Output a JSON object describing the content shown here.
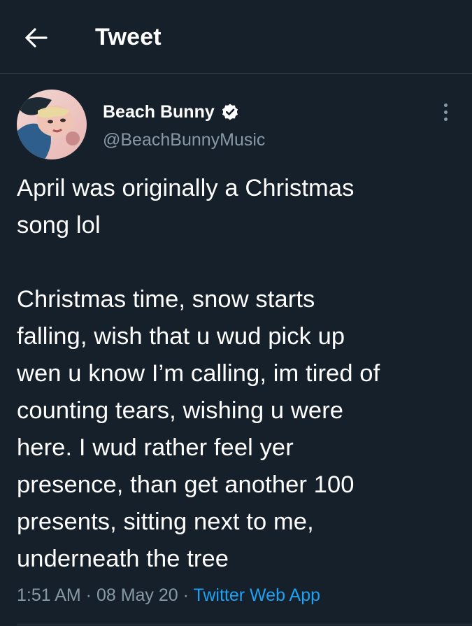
{
  "header": {
    "title": "Tweet",
    "back_icon": "arrow-left-icon"
  },
  "author": {
    "name": "Beach Bunny",
    "handle": "@BeachBunnyMusic",
    "verified_icon": "verified-badge-icon",
    "avatar": "profile-photo"
  },
  "tweet": {
    "text": "April was originally a Christmas\nsong lol\n\nChristmas time, snow starts\nfalling, wish that u wud pick up\nwen u know I’m calling, im tired of\ncounting tears, wishing u were\nhere. I wud rather feel yer\npresence, than get another 100\npresents, sitting next to me,\nunderneath the tree",
    "time": "1:51 AM",
    "separator": " · ",
    "date": "08 May 20",
    "app": "Twitter Web App"
  },
  "more_icon": "more-options-icon",
  "colors": {
    "background": "#15202b",
    "text": "#ffffff",
    "secondary": "#8899a6",
    "accent": "#1da1f2",
    "divider": "#38444d"
  }
}
